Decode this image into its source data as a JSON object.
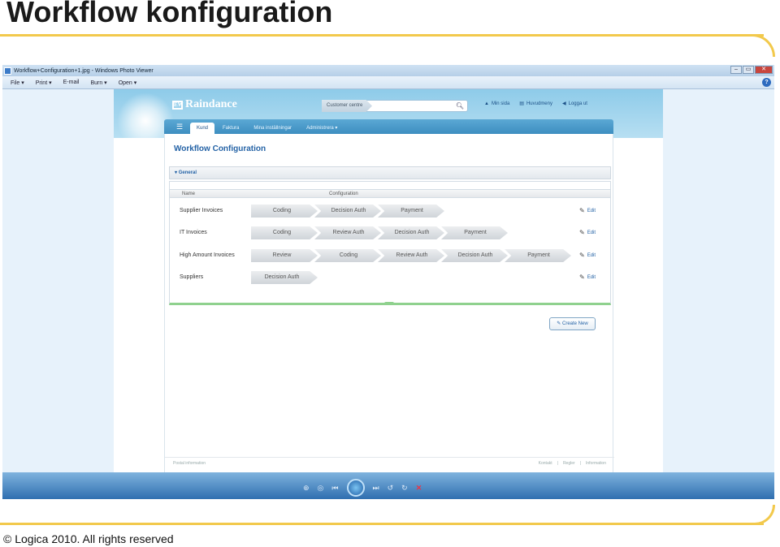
{
  "slide": {
    "title": "Workflow konfiguration",
    "copyright": "© Logica 2010. All rights reserved"
  },
  "window": {
    "title": "Workflow+Configuration+1.jpg - Windows Photo Viewer",
    "controls": [
      "–",
      "▭",
      "✕"
    ]
  },
  "menu": {
    "items": [
      "File ▾",
      "Print ▾",
      "E-mail",
      "Burn ▾",
      "Open ▾"
    ],
    "help": "?"
  },
  "app": {
    "logo": "Raindance",
    "search_label": "Customer centre",
    "search_placeholder": "",
    "links": {
      "mysite": "Min sida",
      "mainmenu": "Huvudmeny",
      "logout": "Logga ut"
    },
    "tabs": [
      "Kund",
      "Faktura",
      "Mina inställningar",
      "Administrera ▾"
    ],
    "page_title": "Workflow Configuration",
    "section": "General",
    "columns": {
      "name": "Name",
      "configuration": "Configuration"
    },
    "rows": [
      {
        "name": "Supplier Invoices",
        "steps": [
          "Coding",
          "Decision Auth",
          "Payment"
        ],
        "edit": "Edit"
      },
      {
        "name": "IT Invoices",
        "steps": [
          "Coding",
          "Review Auth",
          "Decision Auth",
          "Payment"
        ],
        "edit": "Edit"
      },
      {
        "name": "High Amount Invoices",
        "steps": [
          "Review",
          "Coding",
          "Review Auth",
          "Decision Auth",
          "Payment"
        ],
        "edit": "Edit"
      },
      {
        "name": "Suppliers",
        "steps": [
          "Decision Auth"
        ],
        "edit": "Edit"
      }
    ],
    "create_button": "Create New",
    "footer_left": "Postal information",
    "footer_links": [
      "Kontakt",
      "|",
      "Regler",
      "|",
      "Information"
    ]
  }
}
